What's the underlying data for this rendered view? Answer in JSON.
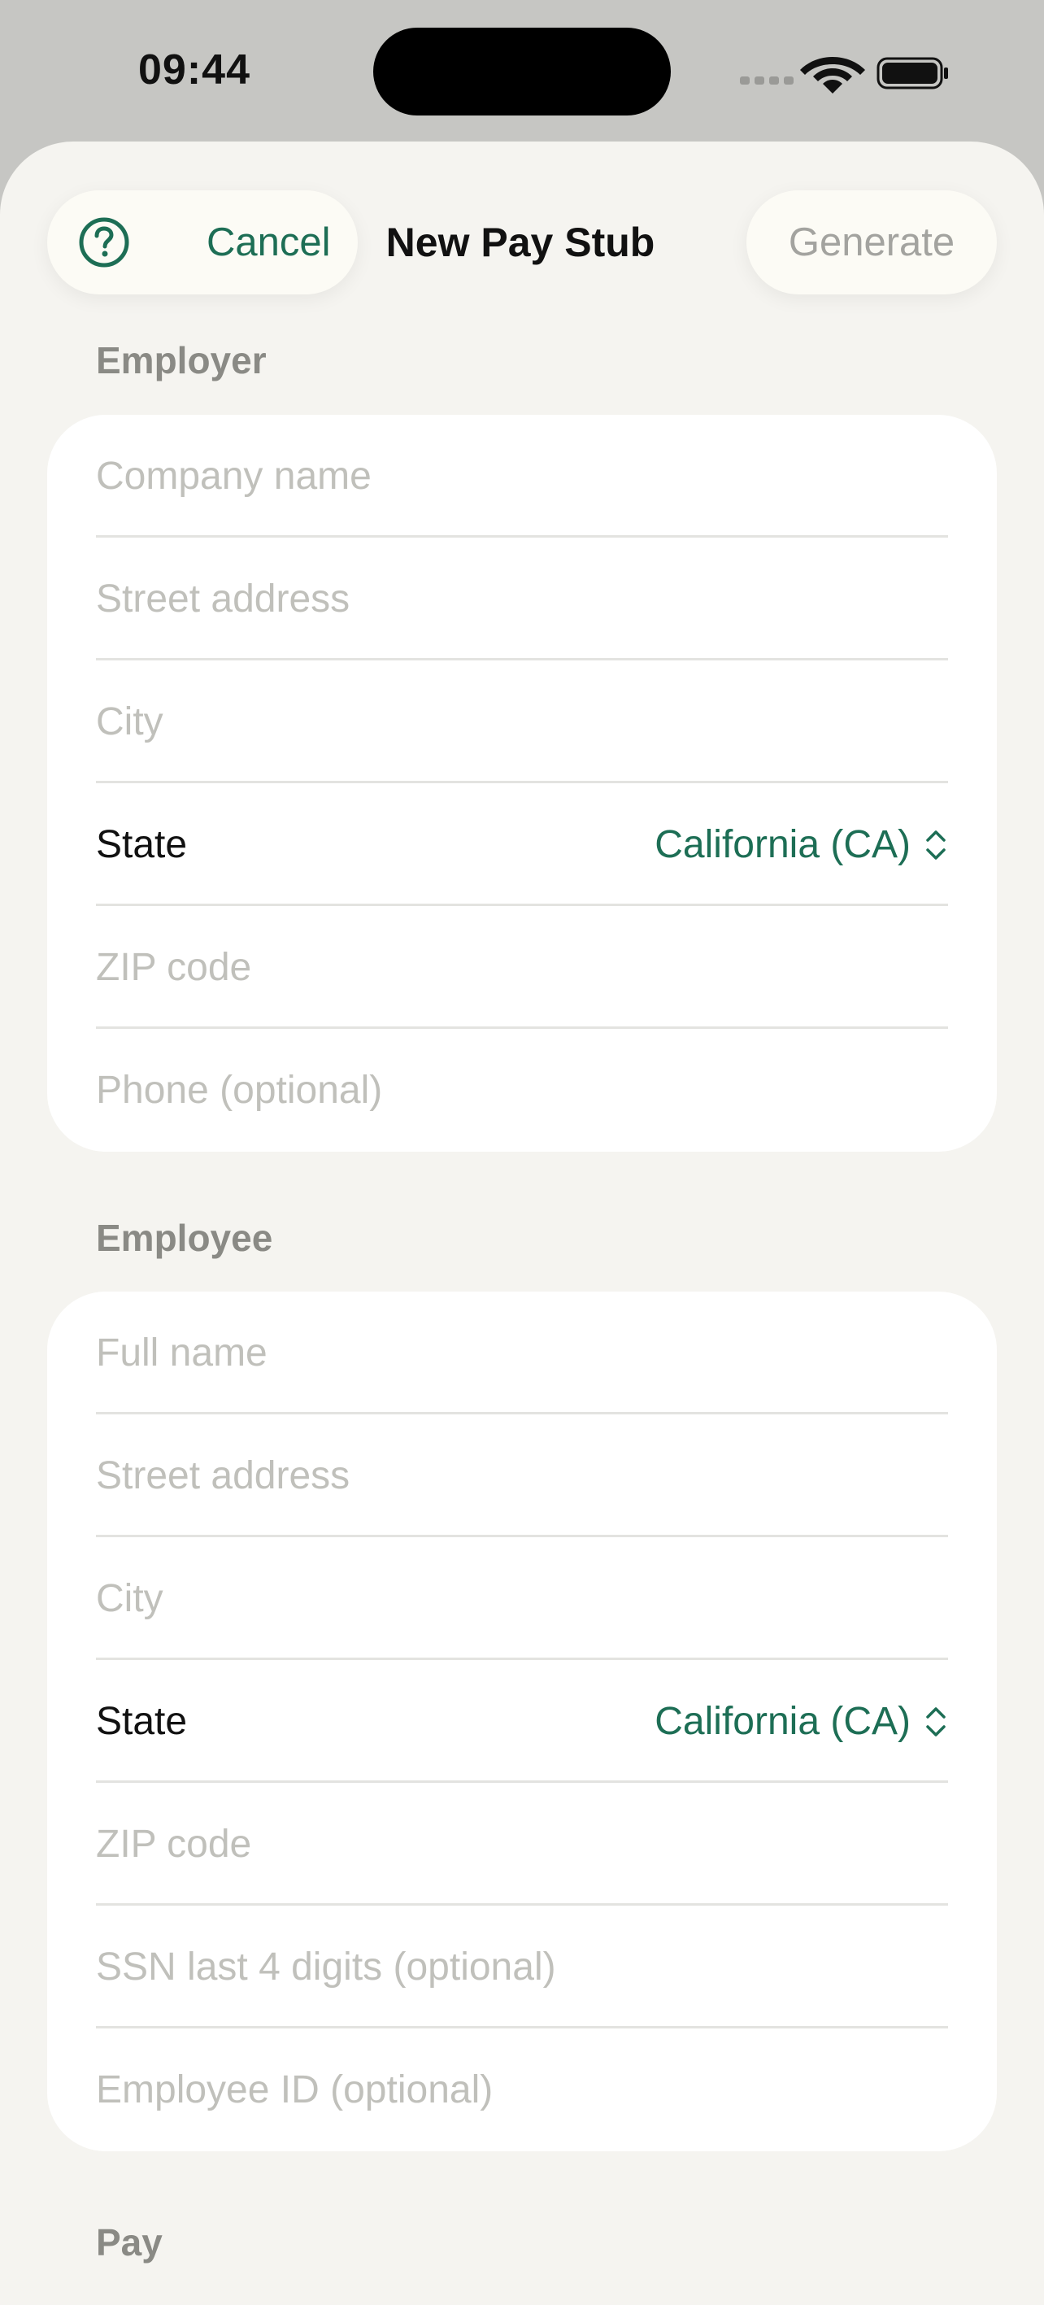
{
  "status_bar": {
    "time": "09:44"
  },
  "nav": {
    "cancel_label": "Cancel",
    "title": "New Pay Stub",
    "generate_label": "Generate"
  },
  "sections": {
    "employer": {
      "title": "Employer",
      "company_name_placeholder": "Company name",
      "street_placeholder": "Street address",
      "city_placeholder": "City",
      "state_label": "State",
      "state_value": "California (CA)",
      "zip_placeholder": "ZIP code",
      "phone_placeholder": "Phone (optional)"
    },
    "employee": {
      "title": "Employee",
      "full_name_placeholder": "Full name",
      "street_placeholder": "Street address",
      "city_placeholder": "City",
      "state_label": "State",
      "state_value": "California (CA)",
      "zip_placeholder": "ZIP code",
      "ssn_placeholder": "SSN last 4 digits (optional)",
      "employee_id_placeholder": "Employee ID (optional)"
    },
    "pay": {
      "title": "Pay"
    }
  },
  "colors": {
    "accent": "#1d6e55",
    "placeholder": "#c0c0bb",
    "section_header": "#8a8a85",
    "disabled": "#a3a39f"
  },
  "icons": {
    "help": "question-circle-icon",
    "state_chevron": "chevron-up-down-icon",
    "signal": "cellular-signal-icon",
    "wifi": "wifi-icon",
    "battery": "battery-icon"
  }
}
